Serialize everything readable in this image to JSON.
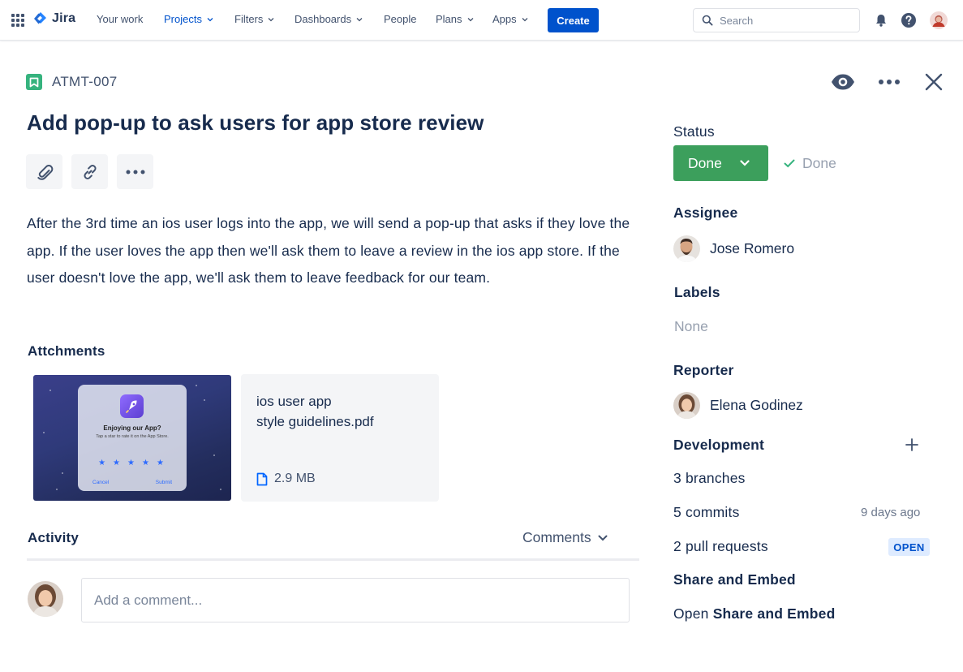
{
  "nav": {
    "logo": "Jira",
    "items": [
      {
        "label": "Your work",
        "dropdown": false,
        "active": false
      },
      {
        "label": "Projects",
        "dropdown": true,
        "active": true
      },
      {
        "label": "Filters",
        "dropdown": true,
        "active": false
      },
      {
        "label": "Dashboards",
        "dropdown": true,
        "active": false
      },
      {
        "label": "People",
        "dropdown": false,
        "active": false
      },
      {
        "label": "Plans",
        "dropdown": true,
        "active": false
      },
      {
        "label": "Apps",
        "dropdown": true,
        "active": false
      }
    ],
    "create_label": "Create",
    "search_placeholder": "Search"
  },
  "issue": {
    "key": "ATMT-007",
    "title": "Add pop-up to ask users for app store review",
    "description": "After the 3rd time an ios user logs into the app, we will send a pop-up that asks if they love the app. If the user loves the app then we'll ask them to leave a review in the ios app store. If the user doesn't love the app, we'll ask them to leave feedback for our team.",
    "attachments_heading": "Attchments",
    "attachment_image": {
      "title": "Enjoying our App?",
      "subtitle": "Tap a star to rate it on the App Store.",
      "cancel": "Cancel",
      "submit": "Submit"
    },
    "attachment_file": {
      "name_line1": "ios user app",
      "name_line2": "style guidelines.pdf",
      "size": "2.9 MB"
    },
    "activity_heading": "Activity",
    "activity_filter": "Comments",
    "comment_placeholder": "Add a comment..."
  },
  "sidebar": {
    "status_label": "Status",
    "status_value": "Done",
    "resolution": "Done",
    "assignee_label": "Assignee",
    "assignee": "Jose Romero",
    "labels_label": "Labels",
    "labels_value": "None",
    "reporter_label": "Reporter",
    "reporter": "Elena Godinez",
    "development_label": "Development",
    "branches": "3 branches",
    "commits": "5 commits",
    "commits_time": "9 days ago",
    "pull_requests": "2 pull requests",
    "pr_status": "OPEN",
    "share_heading": "Share and Embed",
    "share_link_prefix": "Open",
    "share_link_bold": "Share and Embed"
  },
  "colors": {
    "brand_blue": "#0052CC",
    "status_green": "#3C9F5C",
    "story_green": "#36B37E"
  }
}
